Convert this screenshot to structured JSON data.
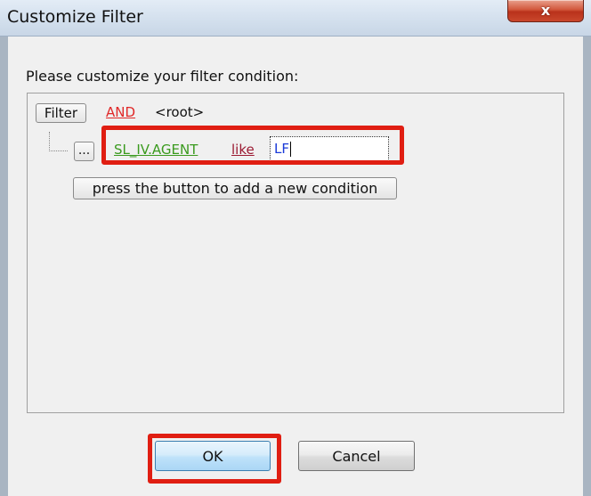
{
  "window": {
    "title": "Customize Filter",
    "close_glyph": "x"
  },
  "prompt": "Please customize your filter condition:",
  "filter": {
    "filter_button": "Filter",
    "group_operator": "AND",
    "root_label": "<root>",
    "condition": {
      "menu_button": "...",
      "field": "SL_IV.AGENT",
      "operator": "like",
      "value": "LF"
    },
    "add_condition_button": "press the button to add a new condition"
  },
  "buttons": {
    "ok": "OK",
    "cancel": "Cancel"
  },
  "colors": {
    "highlight": "#e01e12",
    "group_operator": "#e02828",
    "field": "#3a9a1e",
    "operator": "#9b1a32",
    "value": "#1a3ad8"
  }
}
